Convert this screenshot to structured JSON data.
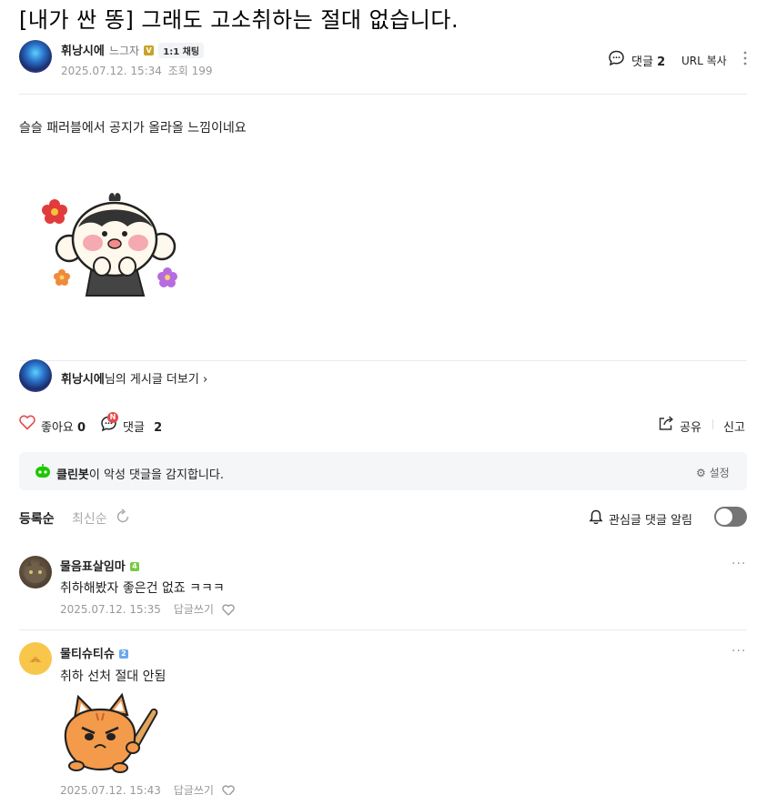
{
  "post": {
    "title": "[내가 싼 똥] 그래도 고소취하는 절대 없습니다.",
    "author": "휘낭시에",
    "grade": "느그자",
    "chat_label": "1:1 채팅",
    "date": "2025.07.12. 15:34",
    "views_label": "조회 199",
    "comment_label": "댓글",
    "comment_count": "2",
    "url_copy": "URL 복사",
    "body": "슬슬 패러블에서 공지가 올라올 느낌이네요"
  },
  "more_posts": {
    "author": "휘낭시에",
    "suffix": "님의 게시글 더보기"
  },
  "actions": {
    "like_label": "좋아요",
    "like_count": "0",
    "comment_label": "댓글",
    "comment_count": "2",
    "new_badge": "N",
    "share_label": "공유",
    "report_label": "신고"
  },
  "cleanbot": {
    "name": "클린봇",
    "text": "이 악성 댓글을 감지합니다.",
    "settings_label": "설정"
  },
  "sort": {
    "by_registration": "등록순",
    "by_latest": "최신순",
    "alarm_label": "관심글 댓글 알림"
  },
  "comments": [
    {
      "name": "물음표살임마",
      "level": "4",
      "text": "취하해봤자 좋은건 없죠 ㅋㅋㅋ",
      "date": "2025.07.12. 15:35",
      "reply_label": "답글쓰기"
    },
    {
      "name": "물티슈티슈",
      "level": "2",
      "text": "취하 선처 절대 안됨",
      "date": "2025.07.12. 15:43",
      "reply_label": "답글쓰기"
    }
  ],
  "colors": {
    "like_heart": "#e5484d",
    "cleanbot_green": "#1ec800",
    "new_badge": "#e5484d",
    "level4": "#7ac943",
    "level2": "#6aa8f0"
  }
}
